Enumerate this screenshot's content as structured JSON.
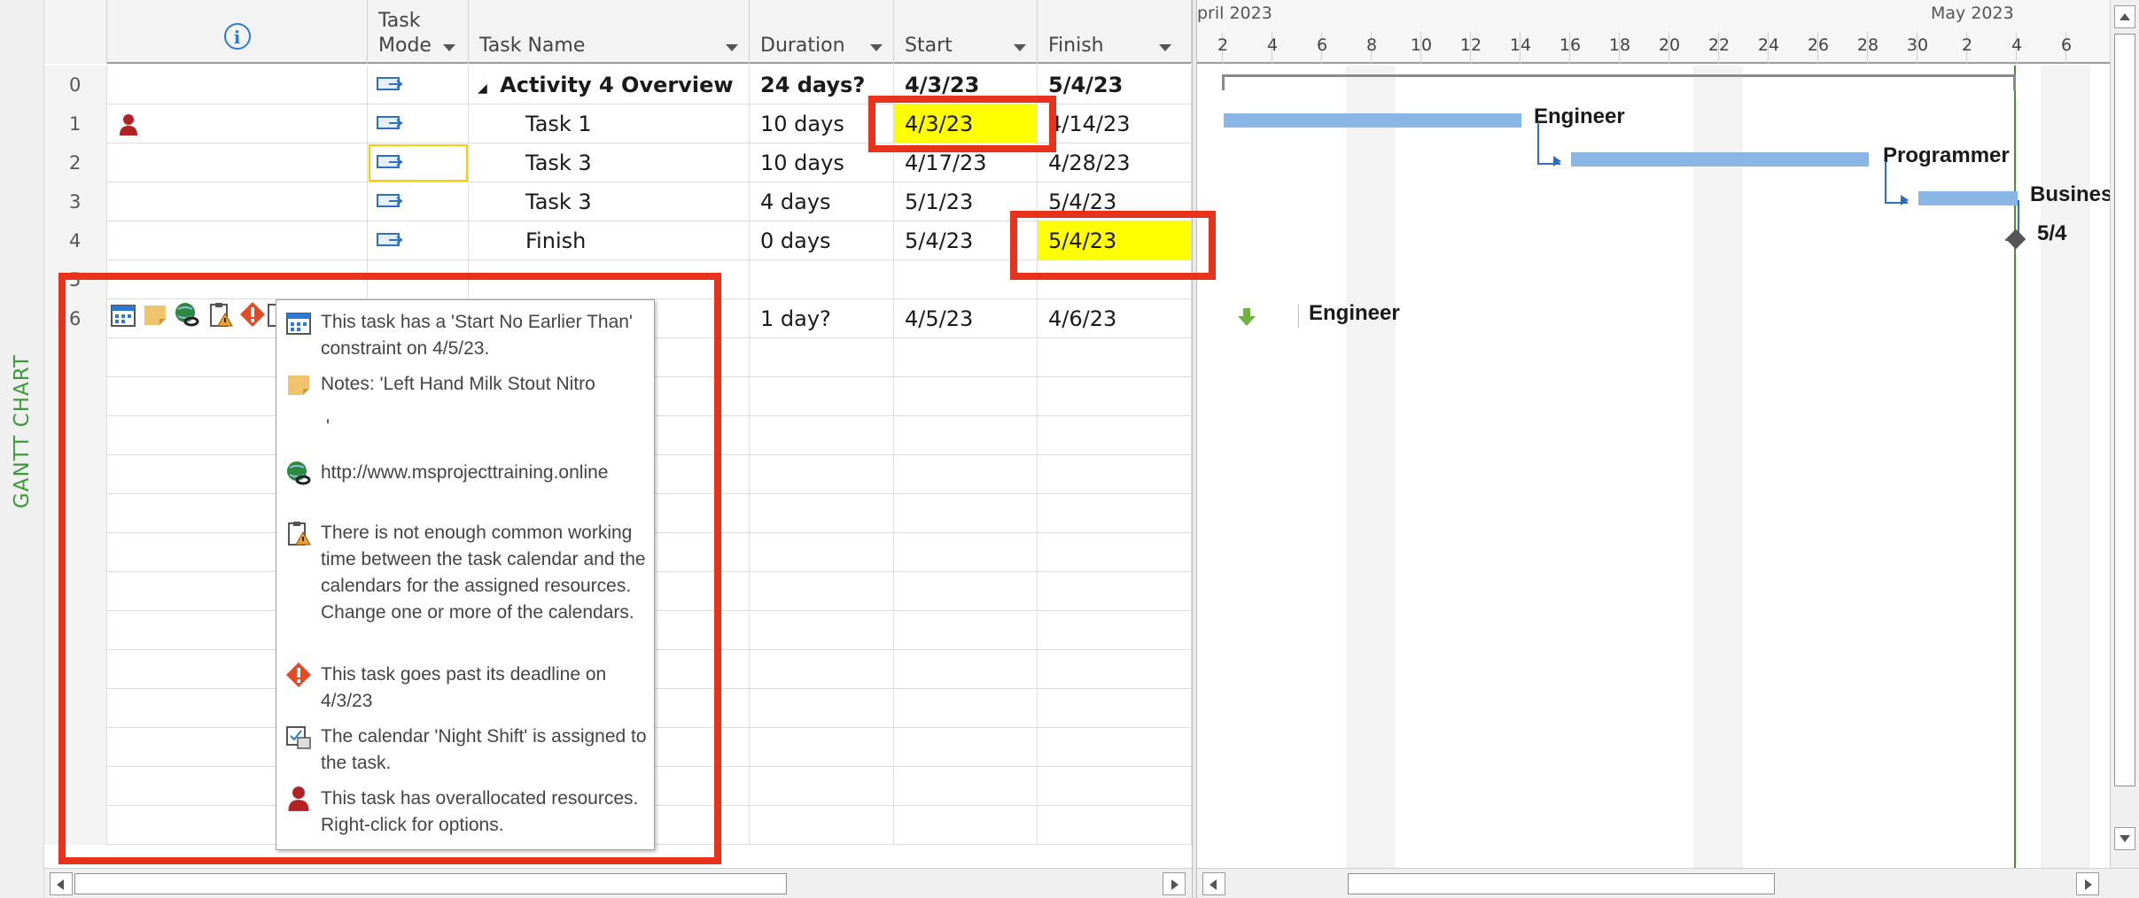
{
  "side_label": "GANTT CHART",
  "columns": {
    "indicators": "i",
    "task_mode": [
      "Task",
      "Mode"
    ],
    "task_name": "Task Name",
    "duration": "Duration",
    "start": "Start",
    "finish": "Finish"
  },
  "rows": [
    {
      "id": "0",
      "name": "Activity 4 Overview",
      "duration": "24 days?",
      "start": "4/3/23",
      "finish": "5/4/23",
      "summary": true
    },
    {
      "id": "1",
      "name": "Task 1",
      "duration": "10 days",
      "start": "4/3/23",
      "finish": "4/14/23"
    },
    {
      "id": "2",
      "name": "Task 3",
      "duration": "10 days",
      "start": "4/17/23",
      "finish": "4/28/23"
    },
    {
      "id": "3",
      "name": "Task 3",
      "duration": "4 days",
      "start": "5/1/23",
      "finish": "5/4/23"
    },
    {
      "id": "4",
      "name": "Finish",
      "duration": "0 days",
      "start": "5/4/23",
      "finish": "5/4/23"
    },
    {
      "id": "5",
      "name": "",
      "duration": "",
      "start": "",
      "finish": ""
    },
    {
      "id": "6",
      "name": "",
      "duration": "1 day?",
      "start": "4/5/23",
      "finish": "4/6/23"
    }
  ],
  "timescale": {
    "months": [
      "pril 2023",
      "May 2023"
    ],
    "days": [
      "2",
      "4",
      "6",
      "8",
      "10",
      "12",
      "14",
      "16",
      "18",
      "20",
      "22",
      "24",
      "26",
      "28",
      "30",
      "2",
      "4",
      "6"
    ]
  },
  "gantt_labels": {
    "task1_resource": "Engineer",
    "task2_resource": "Programmer",
    "task3_resource": "Busines",
    "milestone_label": "5/4",
    "task6_resource": "Engineer"
  },
  "tooltip": {
    "constraint": "This task has a 'Start No Earlier Than' constraint on 4/5/23.",
    "notes": "Notes: 'Left Hand Milk Stout Nitro",
    "notes_cont": "'",
    "hyperlink": "http://www.msprojecttraining.online",
    "calendar_warning": "There is not enough common working time between the task calendar and the calendars for the assigned resources. Change one or more of the calendars.",
    "deadline": "This task goes past its deadline on 4/3/23",
    "calendar_assigned": "The calendar 'Night Shift' is assigned to the task.",
    "overallocated": "This task has overallocated resources. Right-click for options."
  },
  "colors": {
    "highlight_yellow": "#ffff00",
    "red_box": "#e8321c",
    "bar_blue": "#8ab6e6",
    "side_label_green": "#3c9a3c"
  }
}
